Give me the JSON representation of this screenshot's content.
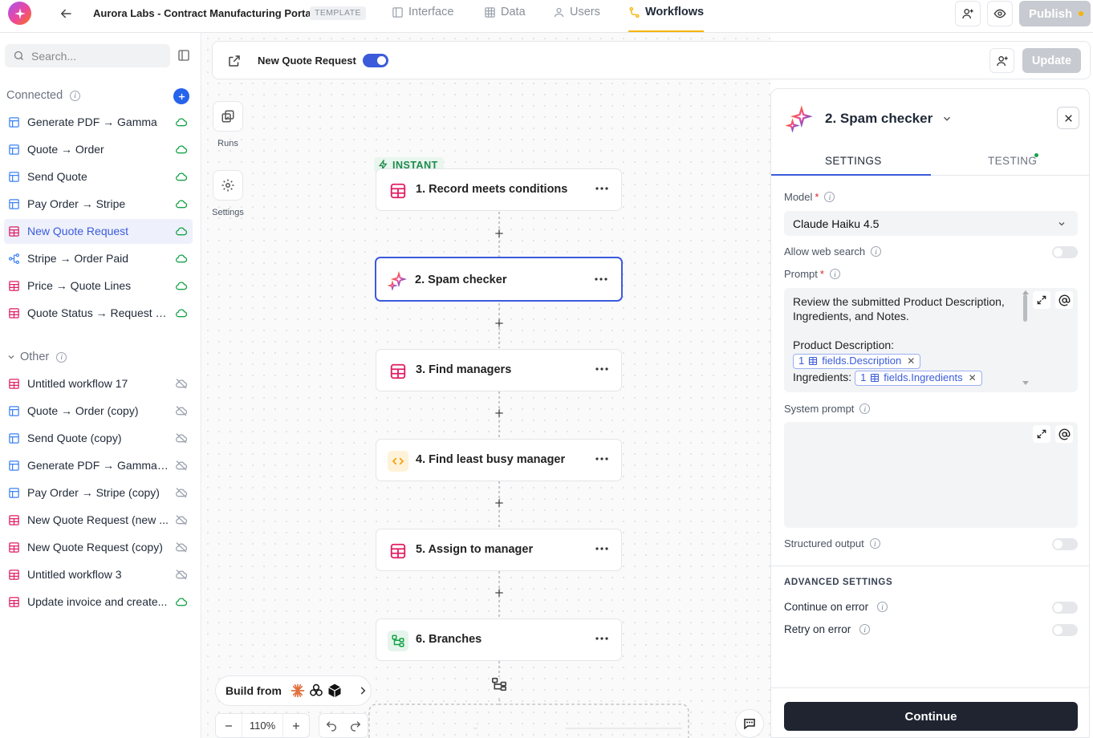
{
  "app": {
    "title": "Aurora Labs - Contract Manufacturing Portal",
    "badge": "TEMPLATE"
  },
  "nav": {
    "tabs": [
      {
        "label": "Interface",
        "icon": "layout-icon"
      },
      {
        "label": "Data",
        "icon": "table-icon"
      },
      {
        "label": "Users",
        "icon": "user-icon"
      },
      {
        "label": "Workflows",
        "icon": "workflow-icon",
        "active": true
      }
    ],
    "publish_label": "Publish"
  },
  "sidebar": {
    "search_placeholder": "Search...",
    "connected_label": "Connected",
    "other_label": "Other",
    "connected": [
      {
        "label": "Generate PDF → Gamma",
        "icon": "layout",
        "status": "cloud"
      },
      {
        "label": "Quote → Order",
        "icon": "layout",
        "status": "cloud"
      },
      {
        "label": "Send Quote",
        "icon": "layout",
        "status": "cloud"
      },
      {
        "label": "Pay Order → Stripe",
        "icon": "layout",
        "status": "cloud"
      },
      {
        "label": "New Quote Request",
        "icon": "table",
        "status": "cloud",
        "active": true
      },
      {
        "label": "Stripe → Order Paid",
        "icon": "webhook",
        "status": "cloud"
      },
      {
        "label": "Price → Quote Lines",
        "icon": "table",
        "status": "cloud"
      },
      {
        "label": "Quote Status → Request S...",
        "icon": "table",
        "status": "cloud"
      }
    ],
    "other": [
      {
        "label": "Untitled workflow 17",
        "icon": "table",
        "status": "cloud-off"
      },
      {
        "label": "Quote → Order (copy)",
        "icon": "layout",
        "status": "cloud-off"
      },
      {
        "label": "Send Quote (copy)",
        "icon": "layout",
        "status": "cloud-off"
      },
      {
        "label": "Generate PDF → Gamma (...",
        "icon": "layout",
        "status": "cloud-off"
      },
      {
        "label": "Pay Order → Stripe (copy)",
        "icon": "layout",
        "status": "cloud-off"
      },
      {
        "label": "New Quote Request (new ...",
        "icon": "table",
        "status": "cloud-off"
      },
      {
        "label": "New Quote Request (copy)",
        "icon": "table",
        "status": "cloud-off"
      },
      {
        "label": "Untitled workflow 3",
        "icon": "table",
        "status": "cloud-off"
      },
      {
        "label": "Update invoice and create...",
        "icon": "table",
        "status": "cloud"
      }
    ]
  },
  "workflow": {
    "name": "New Quote Request",
    "enabled": true,
    "update_label": "Update",
    "runs_label": "Runs",
    "settings_label": "Settings",
    "trigger_badge": "INSTANT",
    "nodes": [
      {
        "label": "1. Record meets conditions",
        "icon": "table"
      },
      {
        "label": "2. Spam checker",
        "icon": "sparkle",
        "selected": true
      },
      {
        "label": "3. Find managers",
        "icon": "table"
      },
      {
        "label": "4. Find least busy manager",
        "icon": "code"
      },
      {
        "label": "5. Assign to manager",
        "icon": "table"
      },
      {
        "label": "6. Branches",
        "icon": "branch"
      }
    ],
    "build_from_label": "Build from",
    "zoom": "110%"
  },
  "panel": {
    "title": "2.  Spam checker",
    "tabs": [
      "SETTINGS",
      "TESTING"
    ],
    "model_label": "Model",
    "model_value": "Claude Haiku 4.5",
    "web_search_label": "Allow web search",
    "prompt_label": "Prompt",
    "prompt_line1": "Review the submitted Product Description, Ingredients, and Notes.",
    "prompt_line2": "Product Description:",
    "chip1": {
      "num": "1",
      "text": "fields.Description"
    },
    "prompt_line3": "Ingredients:",
    "chip2": {
      "num": "1",
      "text": "fields.Ingredients"
    },
    "system_prompt_label": "System prompt",
    "structured_output_label": "Structured output",
    "advanced_title": "ADVANCED SETTINGS",
    "continue_on_error_label": "Continue on error",
    "retry_on_error_label": "Retry on error",
    "continue_label": "Continue"
  },
  "colors": {
    "accent": "#3b5bdb",
    "table_icon": "#e11d63",
    "layout_icon": "#3b82f6",
    "cloud_ok": "#16a34a",
    "code_icon": "#f59e0b",
    "branch_icon": "#16a34a"
  }
}
